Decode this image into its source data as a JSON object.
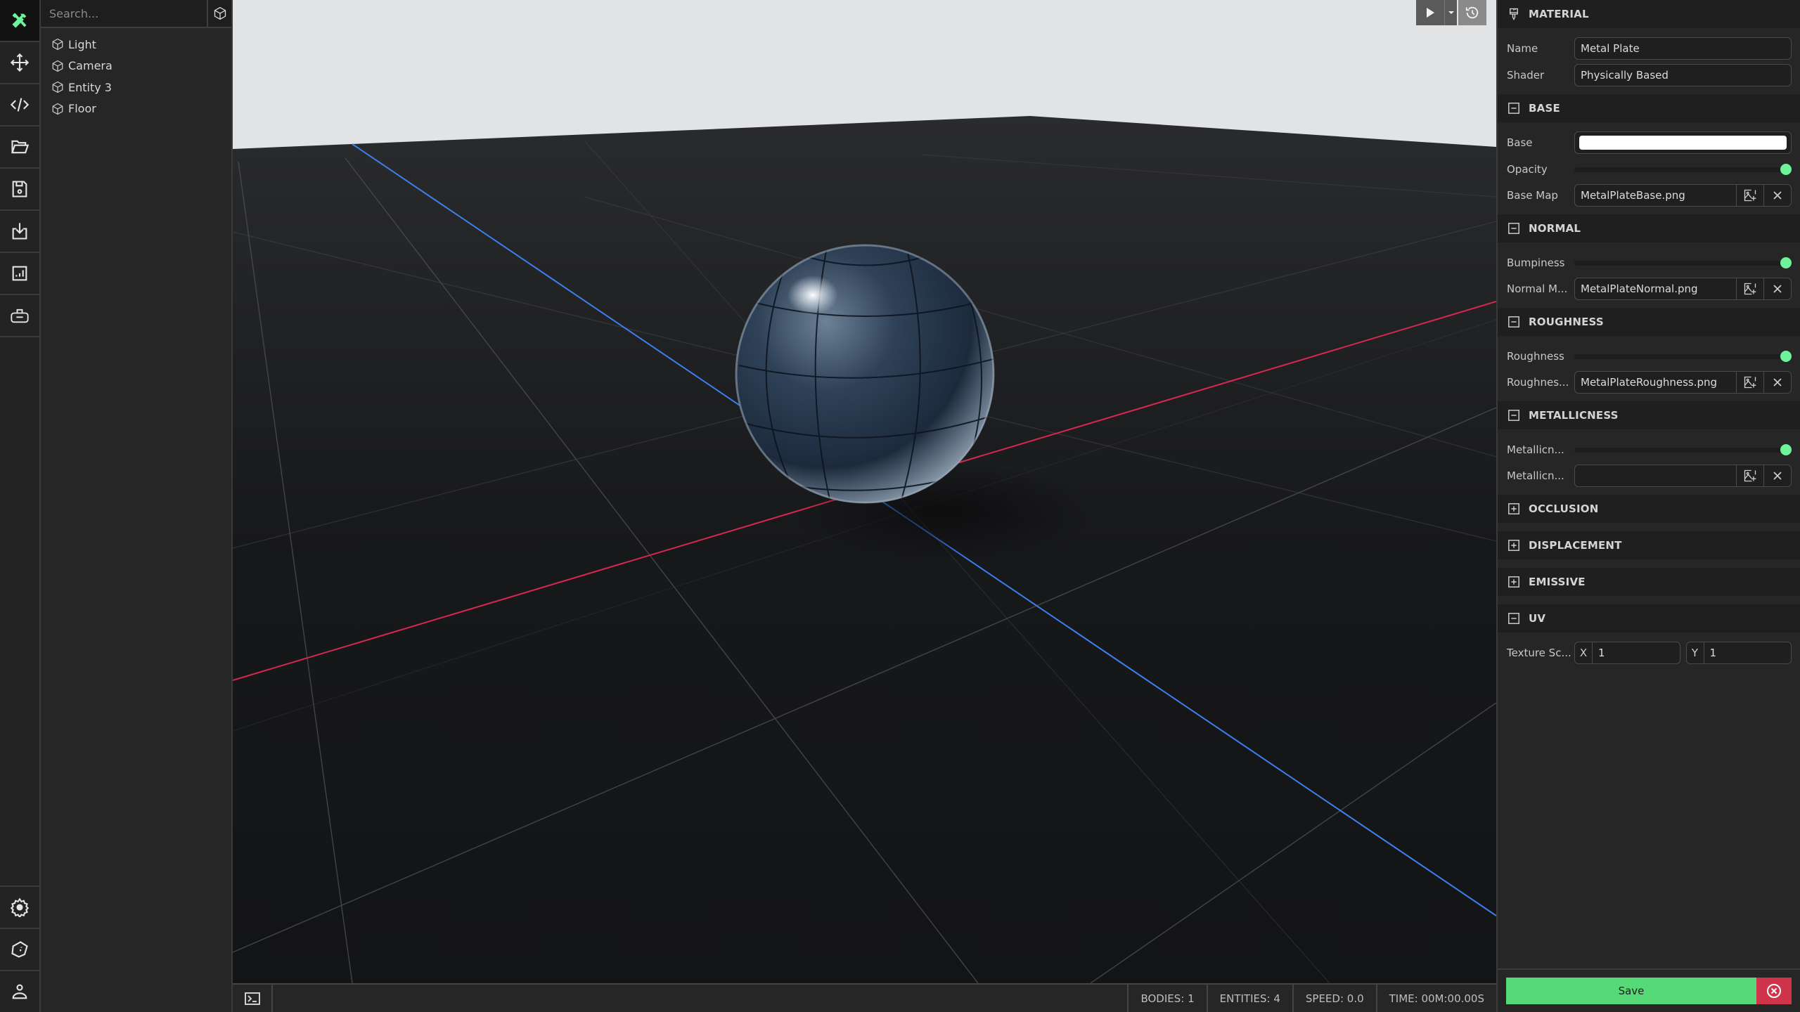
{
  "iconbar": {
    "top": [
      {
        "name": "tools-logo-icon",
        "label": "Tools"
      },
      {
        "name": "move-arrows-icon",
        "label": "Transform"
      },
      {
        "name": "code-icon",
        "label": "Code"
      },
      {
        "name": "folder-open-icon",
        "label": "Open"
      },
      {
        "name": "save-disk-icon",
        "label": "Save"
      },
      {
        "name": "import-download-icon",
        "label": "Import"
      },
      {
        "name": "stats-chart-icon",
        "label": "Statistics"
      },
      {
        "name": "vr-headset-icon",
        "label": "VR"
      }
    ],
    "bottom": [
      {
        "name": "gear-icon",
        "label": "Settings"
      },
      {
        "name": "tag-icon",
        "label": "Tags"
      },
      {
        "name": "user-icon",
        "label": "Account"
      }
    ],
    "accent": "#6ef39a"
  },
  "tree": {
    "search_placeholder": "Search...",
    "search_value": "",
    "items": [
      {
        "label": "Light"
      },
      {
        "label": "Camera"
      },
      {
        "label": "Entity 3"
      },
      {
        "label": "Floor"
      }
    ]
  },
  "viewport": {
    "axis_colors": {
      "x": "#d6294f",
      "z": "#3b7ff0"
    },
    "sky_color": "#e2e4e6",
    "floor_color": "#1a1b1d"
  },
  "status": {
    "bodies": "BODIES: 1",
    "entities": "ENTITIES: 4",
    "speed": "SPEED: 0.0",
    "time": "TIME: 00M:00.00S"
  },
  "panel": {
    "title": "MATERIAL",
    "name_label": "Name",
    "name_value": "Metal Plate",
    "shader_label": "Shader",
    "shader_value": "Physically Based",
    "sections": {
      "base": {
        "title": "BASE",
        "expanded": true,
        "color_label": "Base",
        "color_value": "#ffffff",
        "opacity_label": "Opacity",
        "opacity_value": 1.0,
        "map_label": "Base Map",
        "map_value": "MetalPlateBase.png"
      },
      "normal": {
        "title": "NORMAL",
        "expanded": true,
        "bump_label": "Bumpiness",
        "bump_value": 1.0,
        "map_label": "Normal M...",
        "map_value": "MetalPlateNormal.png"
      },
      "roughness": {
        "title": "ROUGHNESS",
        "expanded": true,
        "value_label": "Roughness",
        "value": 1.0,
        "map_label": "Roughnes...",
        "map_value": "MetalPlateRoughness.png"
      },
      "metallicness": {
        "title": "METALLICNESS",
        "expanded": true,
        "value_label": "Metallicn...",
        "value": 1.0,
        "map_label": "Metallicn...",
        "map_value": ""
      },
      "occlusion": {
        "title": "OCCLUSION",
        "expanded": false
      },
      "displacement": {
        "title": "DISPLACEMENT",
        "expanded": false
      },
      "emissive": {
        "title": "EMISSIVE",
        "expanded": false
      },
      "uv": {
        "title": "UV",
        "expanded": true,
        "scale_label": "Texture Sc...",
        "x_label": "X",
        "x_value": "1",
        "y_label": "Y",
        "y_value": "1"
      }
    },
    "save_label": "Save",
    "save_color": "#56d977",
    "cancel_color": "#cf344a"
  }
}
